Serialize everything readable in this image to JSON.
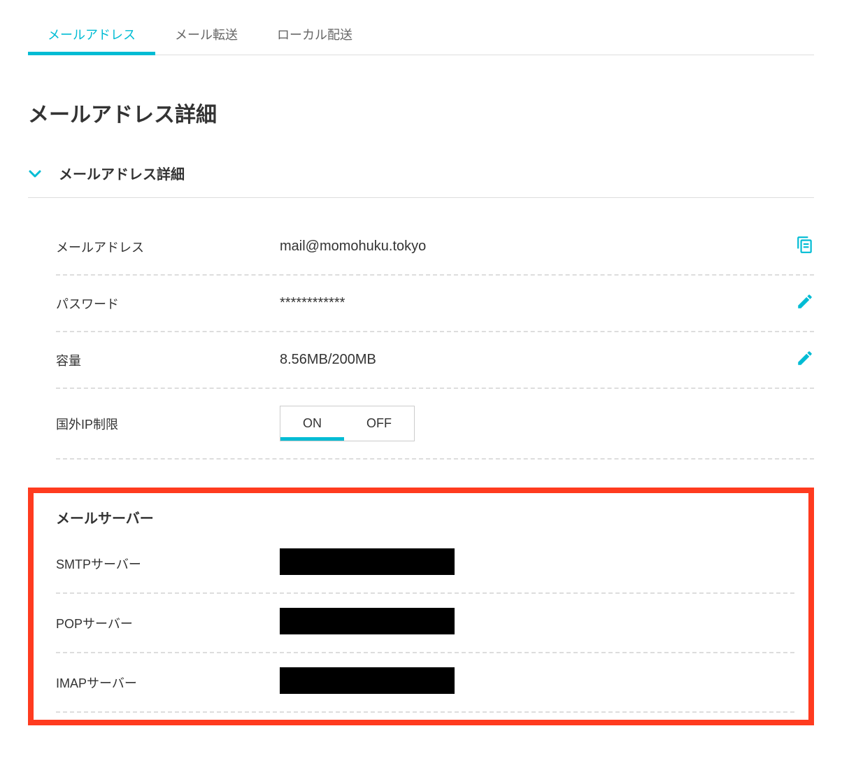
{
  "tabs": [
    {
      "label": "メールアドレス",
      "active": true
    },
    {
      "label": "メール転送",
      "active": false
    },
    {
      "label": "ローカル配送",
      "active": false
    }
  ],
  "page_title": "メールアドレス詳細",
  "section": {
    "title": "メールアドレス詳細"
  },
  "details": {
    "email": {
      "label": "メールアドレス",
      "value": "mail@momohuku.tokyo"
    },
    "password": {
      "label": "パスワード",
      "value": "************"
    },
    "capacity": {
      "label": "容量",
      "value": "8.56MB/200MB"
    },
    "ip_restriction": {
      "label": "国外IP制限",
      "on_label": "ON",
      "off_label": "OFF",
      "active": "ON"
    }
  },
  "server": {
    "title": "メールサーバー",
    "smtp_label": "SMTPサーバー",
    "pop_label": "POPサーバー",
    "imap_label": "IMAPサーバー"
  }
}
